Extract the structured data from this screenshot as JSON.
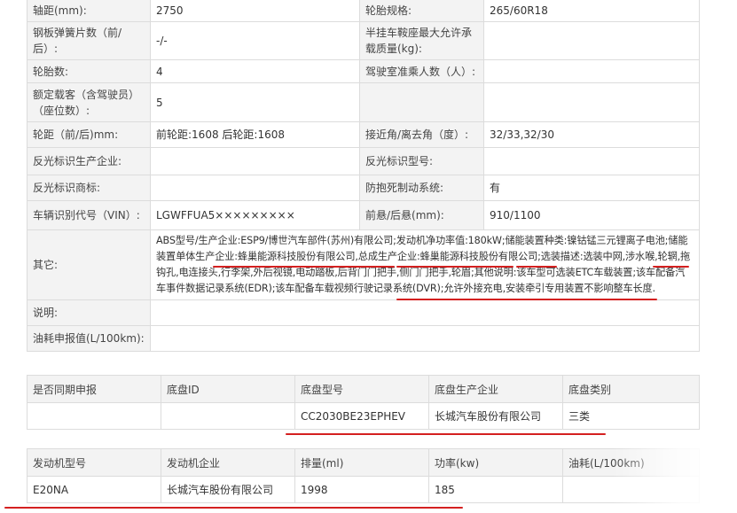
{
  "spec": {
    "rows": [
      {
        "l1": "轴距(mm):",
        "v1": "2750",
        "l2": "轮胎规格:",
        "v2": "265/60R18"
      },
      {
        "l1": "钢板弹簧片数（前/后）:",
        "v1": "-/-",
        "l2": "半挂车鞍座最大允许承载质量(kg):",
        "v2": ""
      },
      {
        "l1": "轮胎数:",
        "v1": "4",
        "l2": "驾驶室准乘人数（人）:",
        "v2": ""
      },
      {
        "l1": "额定载客（含驾驶员）（座位数）:",
        "v1": "5",
        "l2": "",
        "v2": ""
      },
      {
        "l1": "轮距（前/后)mm:",
        "v1": "前轮距:1608 后轮距:1608",
        "l2": "接近角/离去角（度）:",
        "v2": "32/33,32/30"
      },
      {
        "l1": "反光标识生产企业:",
        "v1": "",
        "l2": "反光标识型号:",
        "v2": ""
      },
      {
        "l1": "反光标识商标:",
        "v1": "",
        "l2": "防抱死制动系统:",
        "v2": "有"
      },
      {
        "l1": "车辆识别代号（VIN）:",
        "v1": "LGWFFUA5×××××××××",
        "l2": "前悬/后悬(mm):",
        "v2": "910/1100"
      }
    ],
    "other_label": "其它:",
    "other_text": "ABS型号/生产企业:ESP9/博世汽车部件(苏州)有限公司;发动机净功率值:180kW;储能装置种类:镍钴锰三元锂离子电池;储能装置单体生产企业:蜂巢能源科技股份有限公司,总成生产企业:蜂巢能源科技股份有限公司;选装描述:选装中网,涉水喉,轮辋,拖钩孔,电连接头,行李架,外后视镜,电动踏板,后背门门把手,侧门门把手,轮眉;其他说明:该车型可选装ETC车载装置;该车配备汽车事件数据记录系统(EDR);该车配备车载视频行驶记录系统(DVR);允许外接充电,安装牵引专用装置不影响整车长度.",
    "note_label": "说明:",
    "note_value": "",
    "fuel_label": "油耗申报值(L/100km):",
    "fuel_value": ""
  },
  "chassis": {
    "headers": [
      "是否同期申报",
      "底盘ID",
      "底盘型号",
      "底盘生产企业",
      "底盘类别"
    ],
    "values": [
      "",
      "",
      "CC2030BE23EPHEV",
      "长城汽车股份有限公司",
      "三类"
    ]
  },
  "engine": {
    "headers": [
      "发动机型号",
      "发动机企业",
      "排量(ml)",
      "功率(kw)",
      "油耗(L/100km)"
    ],
    "values": [
      "E20NA",
      "长城汽车股份有限公司",
      "1998",
      "185",
      ""
    ]
  },
  "colors": {
    "underline": "#d42020",
    "label_bg": "#f3f3f3",
    "border": "#dcdcdc"
  }
}
